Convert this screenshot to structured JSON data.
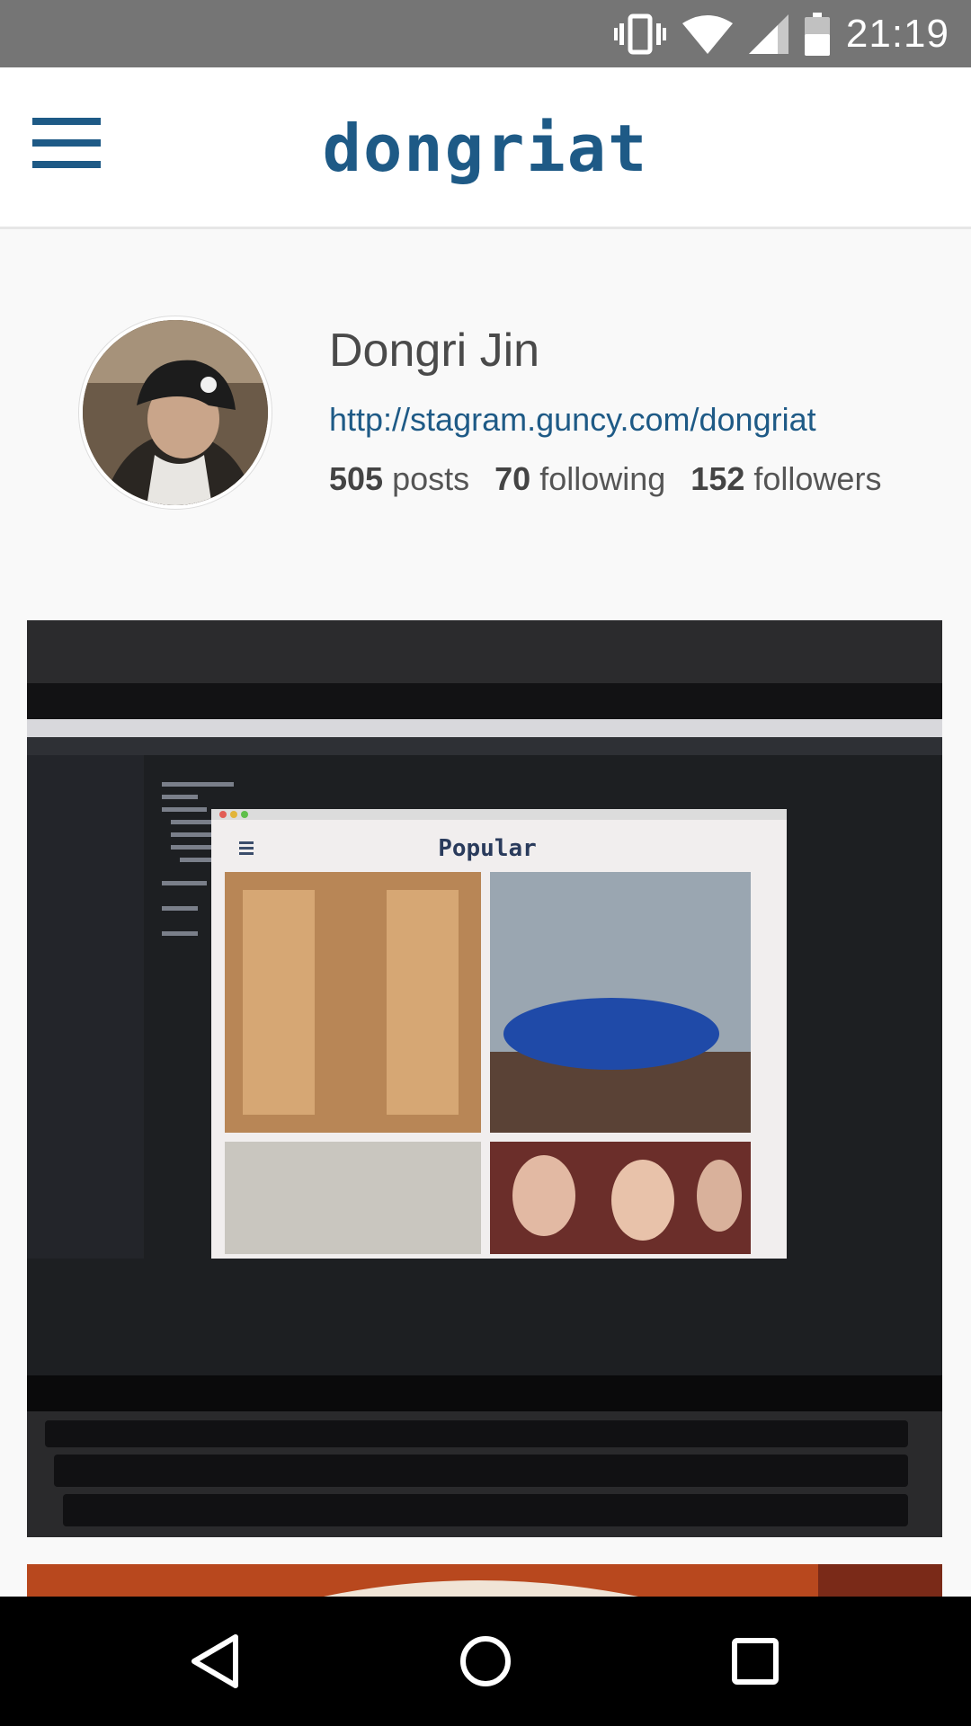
{
  "status_bar": {
    "time": "21:19",
    "icons": [
      "vibrate-icon",
      "wifi-icon",
      "cell-signal-icon",
      "battery-icon"
    ]
  },
  "app_bar": {
    "title": "dongriat",
    "menu_icon": "hamburger-menu-icon"
  },
  "profile": {
    "name": "Dongri Jin",
    "url": "http://stagram.guncy.com/dongriat",
    "stats": [
      {
        "count": "505",
        "label": "posts"
      },
      {
        "count": "70",
        "label": "following"
      },
      {
        "count": "152",
        "label": "followers"
      }
    ]
  },
  "post_1": {
    "inner_app_title": "Popular"
  },
  "nav_bar": {
    "icons": [
      "back-icon",
      "home-icon",
      "recents-icon"
    ]
  },
  "colors": {
    "accent": "#1e5a86",
    "status_bar": "#757575",
    "background": "#f9f9f9"
  }
}
